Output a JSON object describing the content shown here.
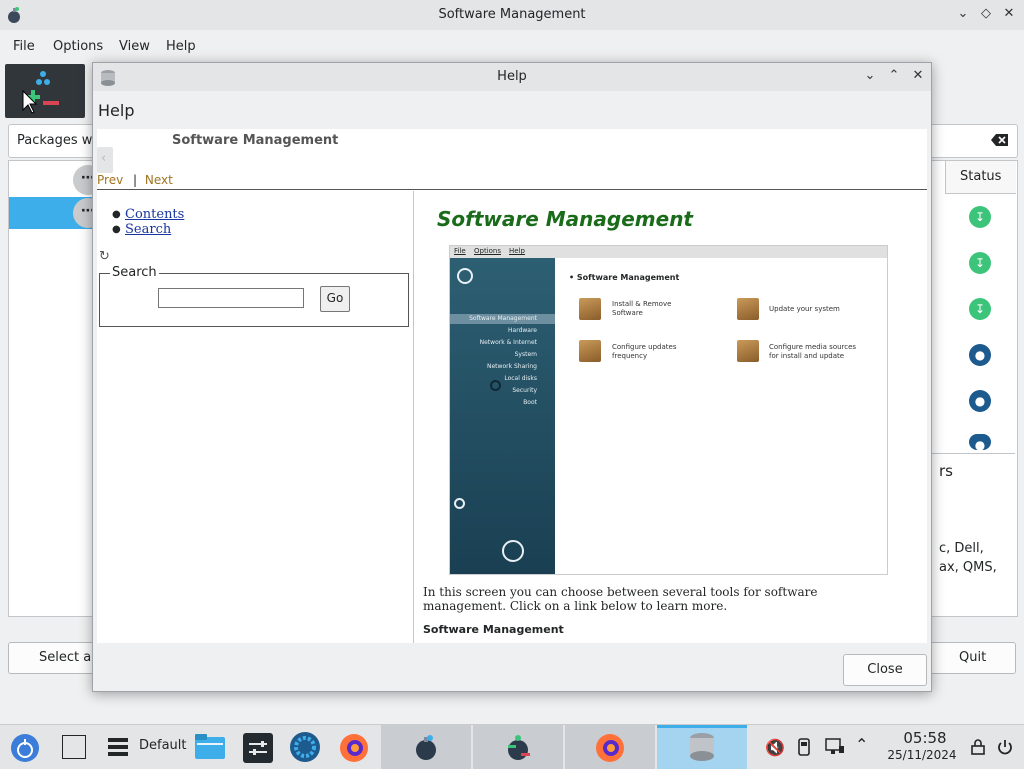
{
  "main_window": {
    "title": "Software Management",
    "menu": [
      "File",
      "Options",
      "View",
      "Help"
    ],
    "search_label": "Packages wi",
    "status_header": "Status",
    "description_fragments": [
      "rs",
      "c, Dell,",
      "ax, QMS,"
    ],
    "select_all_label": "Select al",
    "quit_label": "Quit"
  },
  "help_window": {
    "title": "Help",
    "header": "Help",
    "nav_title": "Software Management",
    "prev_label": "Prev",
    "next_label": "Next",
    "nav_separator": "|",
    "toc": [
      "Contents",
      "Search"
    ],
    "search_legend": "Search",
    "search_value": "",
    "go_label": "Go",
    "page_title": "Software Management",
    "screenshot": {
      "menu": [
        "File",
        "Options",
        "Help"
      ],
      "sidebar": [
        "Software Management",
        "Hardware",
        "Network & Internet",
        "System",
        "Network Sharing",
        "Local disks",
        "Security",
        "Boot"
      ],
      "heading": "Software Management",
      "items": [
        {
          "label": "Install & Remove\nSoftware"
        },
        {
          "label": "Update your system"
        },
        {
          "label": "Configure updates\nfrequency"
        },
        {
          "label": "Configure media sources\nfor install and update"
        }
      ]
    },
    "intro_text": "In this screen you can choose between several tools for software management. Click on a link below to learn more.",
    "section_heading": "Software Management",
    "close_label": "Close"
  },
  "taskbar": {
    "activity_label": "Default",
    "clock_time": "05:58",
    "clock_date": "25/11/2024"
  },
  "colors": {
    "accent": "#3daee9",
    "title_green": "#1a6b1a",
    "link_blue": "#1a35a0",
    "nav_link": "#a0741e"
  }
}
